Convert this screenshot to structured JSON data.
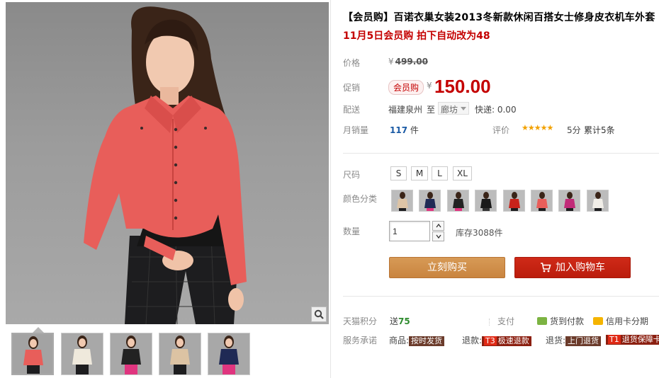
{
  "product": {
    "title": "【会员购】百诺衣巢女装2013冬新款休闲百搭女士修身皮衣机车外套",
    "subtitle": "11月5日会员购 拍下自动改为48"
  },
  "price": {
    "label": "价格",
    "currency": "¥",
    "original": "499.00"
  },
  "promo": {
    "label": "促销",
    "tag": "会员购",
    "currency": "¥",
    "price": "150.00"
  },
  "shipping": {
    "label": "配送",
    "from": "福建泉州",
    "to_word": "至",
    "destination": "廊坊",
    "fee": "快递: 0.00"
  },
  "sales": {
    "label": "月销量",
    "count": "117",
    "unit": "件",
    "rating_label": "评价",
    "stars": "★★★★★",
    "score": "5分",
    "reviews": "累计5条"
  },
  "sizes": {
    "label": "尺码",
    "options": [
      "S",
      "M",
      "L",
      "XL"
    ]
  },
  "colors": {
    "label": "颜色分类",
    "options": [
      "beige",
      "navy",
      "black-pink",
      "black",
      "red",
      "coral",
      "magenta",
      "white"
    ]
  },
  "quantity": {
    "label": "数量",
    "value": "1",
    "stock": "库存3088件"
  },
  "actions": {
    "buy_now": "立刻购买",
    "add_to_cart": "加入购物车"
  },
  "points": {
    "label": "天猫积分",
    "prefix": "送",
    "value": "75"
  },
  "payment": {
    "label": "支付",
    "cod": "货到付款",
    "installment": "信用卡分期"
  },
  "service": {
    "label": "服务承诺",
    "goods_label": "商品:",
    "goods_tag": "按时发货",
    "refund_label": "退款:",
    "refund_code": "T3",
    "refund_tag": "极速退款",
    "return_label": "退货:",
    "return_tag": "上门退货",
    "guarantee_code": "T1",
    "guarantee_tag": "退货保障卡"
  },
  "colors_palette": {
    "title": "#000000",
    "accent_red": "#c40000",
    "buy_button": "#c9843f",
    "cart_button": "#bb1c0c",
    "jacket": "#e85e5a"
  }
}
